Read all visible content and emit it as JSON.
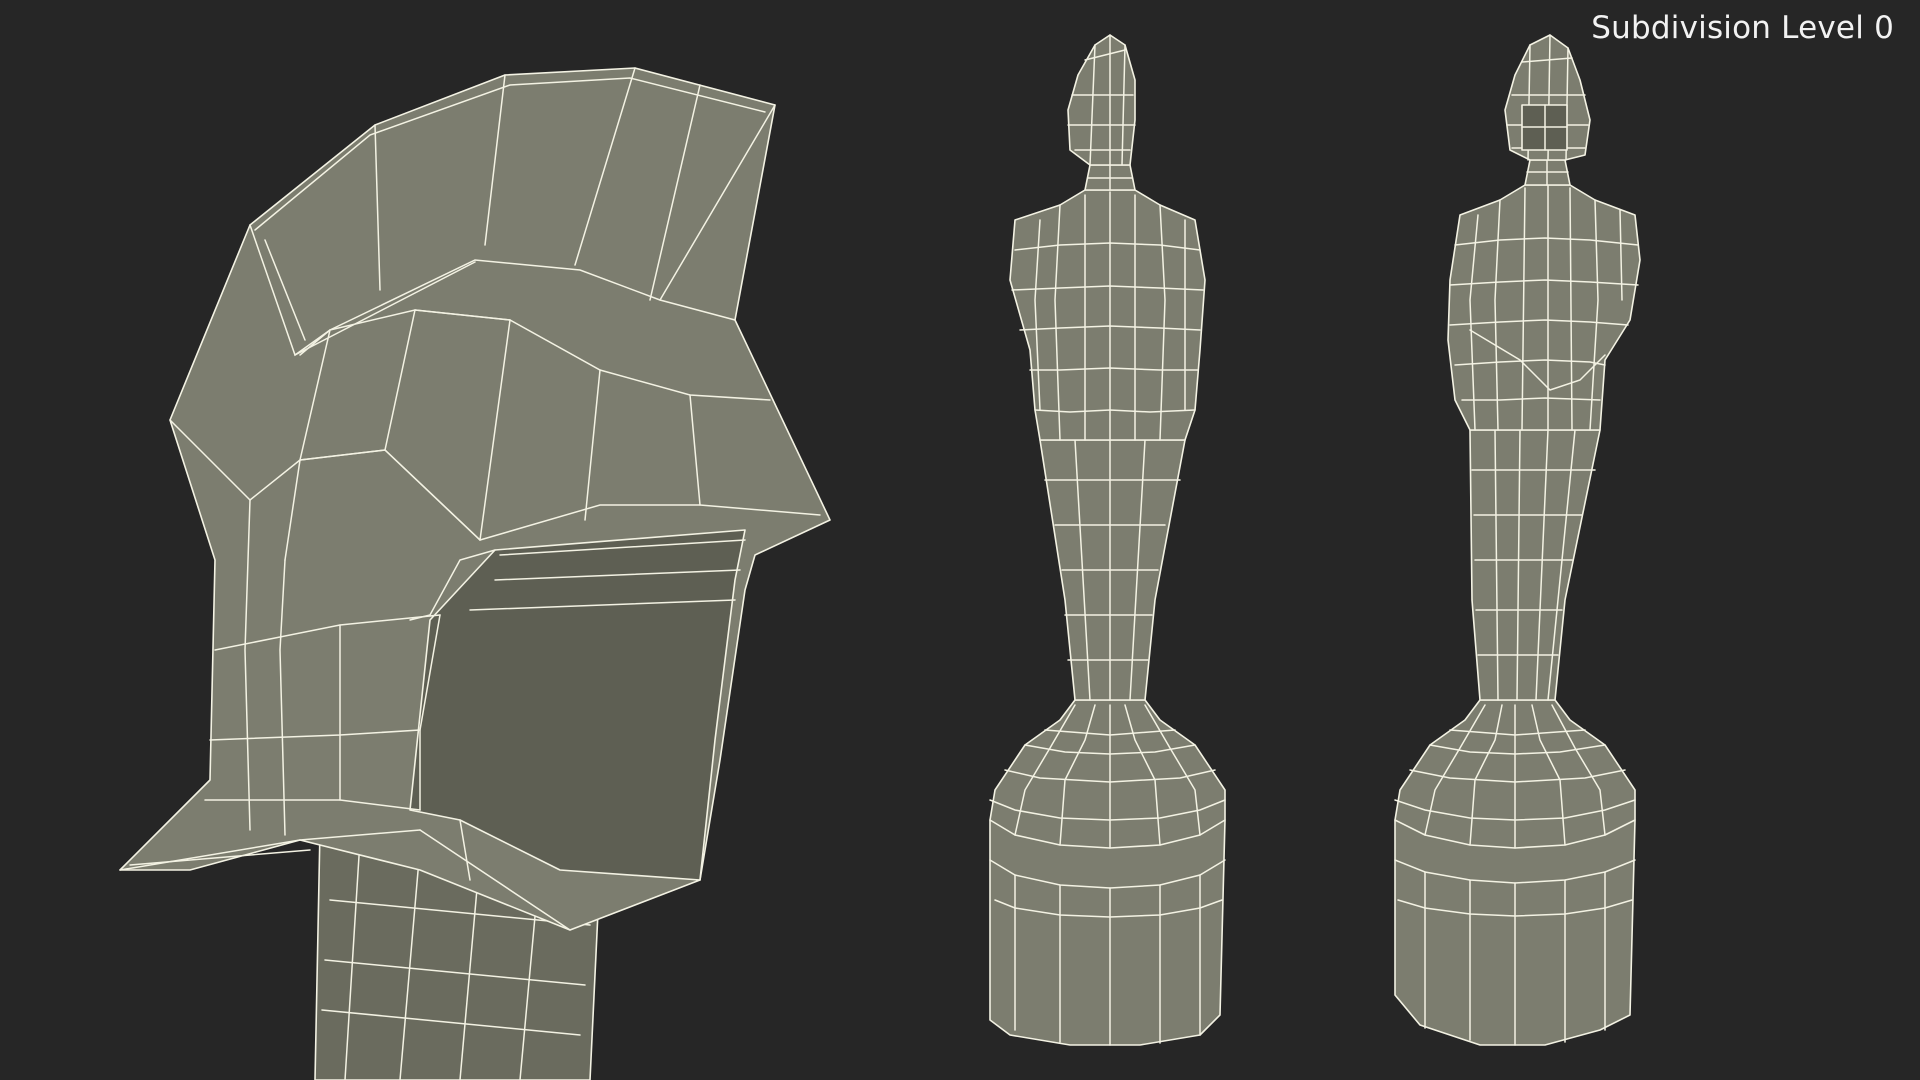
{
  "viewport": {
    "background": "#262626",
    "mesh_color": "#7c7d6f",
    "wire_color": "#f3f2e3",
    "subdivision_label": "Subdivision Level 0"
  },
  "views": [
    {
      "view": "head-closeup"
    },
    {
      "view": "figure-back"
    },
    {
      "view": "figure-front"
    }
  ]
}
